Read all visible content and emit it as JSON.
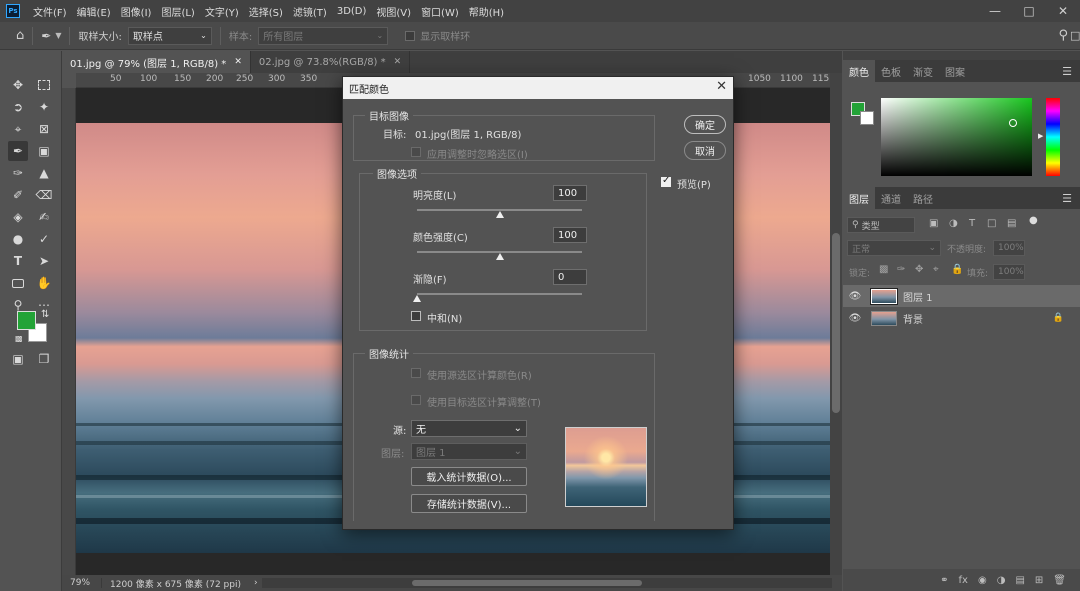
{
  "app": {
    "logo": "Ps"
  },
  "menu": [
    "文件(F)",
    "编辑(E)",
    "图像(I)",
    "图层(L)",
    "文字(Y)",
    "选择(S)",
    "滤镜(T)",
    "3D(D)",
    "视图(V)",
    "窗口(W)",
    "帮助(H)"
  ],
  "options": {
    "sample_size_label": "取样大小:",
    "sample_size_value": "取样点",
    "sample_label": "样本:",
    "sample_value": "所有图层",
    "show_ring_label": "显示取样环"
  },
  "tabs": [
    {
      "label": "01.jpg @ 79% (图层 1, RGB/8) *"
    },
    {
      "label": "02.jpg @ 73.8%(RGB/8) *"
    }
  ],
  "ruler_h": [
    "50",
    "100",
    "150",
    "200",
    "250",
    "300",
    "350",
    "1050",
    "1100",
    "115"
  ],
  "status": {
    "zoom": "79%",
    "doc_size": "1200 像素 x 675 像素 (72 ppi)"
  },
  "color_panel": {
    "tabs": [
      "颜色",
      "色板",
      "渐变",
      "图案"
    ],
    "fg_color": "#23a337",
    "bg_color": "#ffffff"
  },
  "layers_panel": {
    "tabs": [
      "图层",
      "通道",
      "路径"
    ],
    "filter_label": "类型",
    "blend_mode": "正常",
    "opacity_label": "不透明度:",
    "opacity_value": "100%",
    "lock_label": "锁定:",
    "fill_label": "填充:",
    "fill_value": "100%",
    "layers": [
      {
        "name": "图层 1",
        "selected": true
      },
      {
        "name": "背景",
        "locked": true
      }
    ]
  },
  "dialog": {
    "title": "匹配颜色",
    "target_group": "目标图像",
    "target_label": "目标:",
    "target_value": "01.jpg(图层 1, RGB/8)",
    "ignore_selection": "应用调整时忽略选区(I)",
    "image_options_group": "图像选项",
    "luminance_label": "明亮度(L)",
    "luminance_value": "100",
    "luminance_pct": 0.5,
    "intensity_label": "颜色强度(C)",
    "intensity_value": "100",
    "intensity_pct": 0.5,
    "fade_label": "渐隐(F)",
    "fade_value": "0",
    "fade_pct": 0.0,
    "neutralize": "中和(N)",
    "stats_group": "图像统计",
    "use_source_selection": "使用源选区计算颜色(R)",
    "use_target_selection": "使用目标选区计算调整(T)",
    "source_label": "源:",
    "source_value": "无",
    "layer_label": "图层:",
    "layer_value": "图层 1",
    "load_stats": "载入统计数据(O)...",
    "save_stats": "存储统计数据(V)...",
    "ok": "确定",
    "cancel": "取消",
    "preview": "预览(P)",
    "preview_checked": true
  }
}
